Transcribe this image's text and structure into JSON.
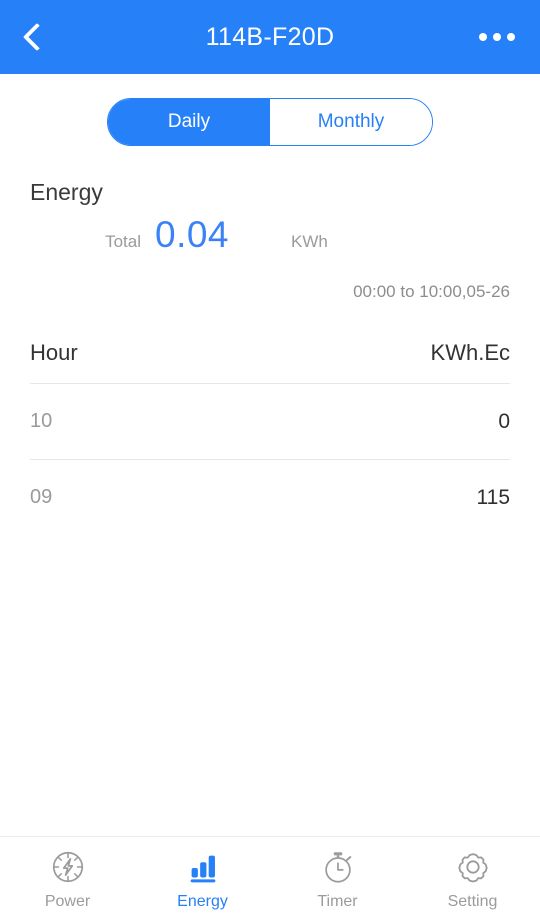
{
  "header": {
    "title": "114B-F20D",
    "back_icon": "chevron-left-icon",
    "menu_icon": "more-options-icon"
  },
  "segmented_control": {
    "options": [
      {
        "label": "Daily",
        "active": true
      },
      {
        "label": "Monthly",
        "active": false
      }
    ]
  },
  "energy": {
    "section_title": "Energy",
    "total_label": "Total",
    "total_value": "0.04",
    "unit": "KWh",
    "range": "00:00 to 10:00,05-26"
  },
  "table": {
    "columns": [
      "Hour",
      "KWh.Ec"
    ],
    "rows": [
      {
        "hour": "10",
        "value": "0"
      },
      {
        "hour": "09",
        "value": "115"
      }
    ]
  },
  "tabbar": {
    "items": [
      {
        "label": "Power",
        "icon": "power-gauge-icon",
        "active": false
      },
      {
        "label": "Energy",
        "icon": "bar-chart-icon",
        "active": true
      },
      {
        "label": "Timer",
        "icon": "stopwatch-icon",
        "active": false
      },
      {
        "label": "Setting",
        "icon": "gear-icon",
        "active": false
      }
    ]
  },
  "colors": {
    "accent": "#2680f8",
    "value_blue": "#3b82f6",
    "muted": "#9a9a9a",
    "divider": "#e6e6e6"
  }
}
